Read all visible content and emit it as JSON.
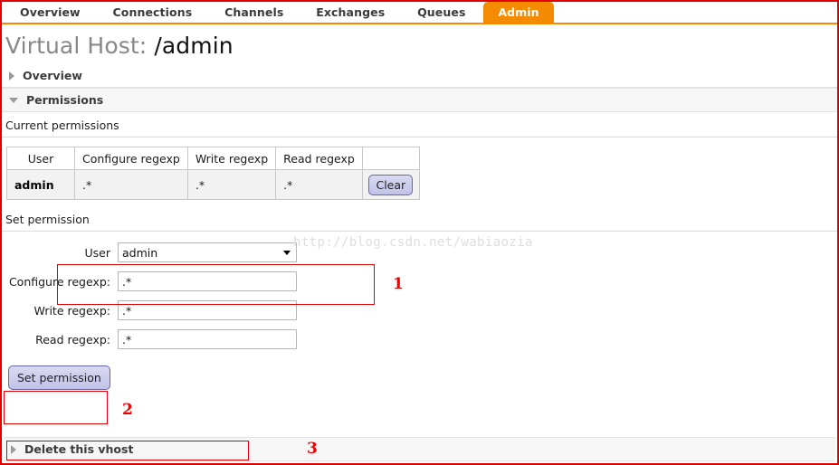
{
  "nav": {
    "tabs": [
      {
        "label": "Overview",
        "active": false
      },
      {
        "label": "Connections",
        "active": false
      },
      {
        "label": "Channels",
        "active": false
      },
      {
        "label": "Exchanges",
        "active": false
      },
      {
        "label": "Queues",
        "active": false
      },
      {
        "label": "Admin",
        "active": true
      }
    ],
    "active_color": "#f58b00"
  },
  "page": {
    "title_prefix": "Virtual Host:",
    "vhost_name": "/admin"
  },
  "sections": {
    "overview": {
      "label": "Overview",
      "expanded": false,
      "icon": "triangle-right-icon"
    },
    "permissions": {
      "label": "Permissions",
      "expanded": true,
      "icon": "triangle-down-icon"
    },
    "delete_vhost": {
      "label": "Delete this vhost",
      "expanded": false,
      "icon": "triangle-right-icon"
    }
  },
  "current_permissions": {
    "label": "Current permissions",
    "columns": [
      "User",
      "Configure regexp",
      "Write regexp",
      "Read regexp",
      ""
    ],
    "rows": [
      {
        "user": "admin",
        "configure": ".*",
        "write": ".*",
        "read": ".*",
        "action_label": "Clear"
      }
    ]
  },
  "set_permission": {
    "label": "Set permission",
    "fields": {
      "user": {
        "label": "User",
        "value": "admin",
        "options": [
          "admin"
        ],
        "icon": "chevron-down-icon"
      },
      "configure": {
        "label": "Configure regexp:",
        "value": ".*",
        "placeholder": ""
      },
      "write": {
        "label": "Write regexp:",
        "value": ".*",
        "placeholder": ""
      },
      "read": {
        "label": "Read regexp:",
        "value": ".*",
        "placeholder": ""
      }
    },
    "submit_label": "Set permission"
  },
  "annotations": {
    "color": "#ee0000",
    "markers": [
      {
        "number": "1",
        "target": "user-select-row"
      },
      {
        "number": "2",
        "target": "set-permission-button"
      },
      {
        "number": "3",
        "target": "delete-this-vhost-section"
      }
    ]
  },
  "watermark": {
    "text": "http://blog.csdn.net/wabiaozia"
  }
}
